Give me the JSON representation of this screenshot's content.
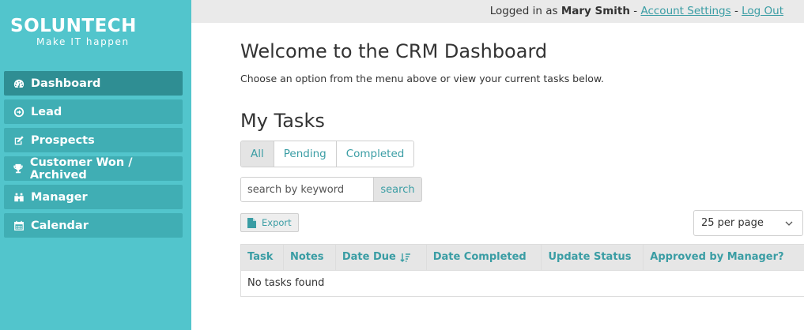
{
  "brand": {
    "name": "SOLUNTECH",
    "tagline": "Make IT happen"
  },
  "sidebar": {
    "items": [
      {
        "label": "Dashboard",
        "icon": "dashboard-icon",
        "active": true
      },
      {
        "label": "Lead",
        "icon": "arrow-circle-icon"
      },
      {
        "label": "Prospects",
        "icon": "edit-icon"
      },
      {
        "label": "Customer Won / Archived",
        "icon": "trophy-icon"
      },
      {
        "label": "Manager",
        "icon": "binoculars-icon"
      },
      {
        "label": "Calendar",
        "icon": "calendar-icon"
      }
    ]
  },
  "topbar": {
    "prefix": "Logged in as",
    "user": "Mary Smith",
    "separator": "-",
    "account_settings": "Account Settings",
    "logout": "Log Out"
  },
  "main": {
    "title": "Welcome to the CRM Dashboard",
    "subtitle": "Choose an option from the menu above or view your current tasks below.",
    "tasks_title": "My Tasks",
    "tabs": [
      {
        "label": "All",
        "active": true
      },
      {
        "label": "Pending"
      },
      {
        "label": "Completed"
      }
    ],
    "search": {
      "placeholder": "search by keyword",
      "value": "",
      "button": "search"
    },
    "export_label": "Export",
    "per_page": "25 per page",
    "table": {
      "columns": [
        "Task",
        "Notes",
        "Date Due",
        "Date Completed",
        "Update Status",
        "Approved by Manager?"
      ],
      "empty_message": "No tasks found"
    }
  },
  "colors": {
    "sidebar_bg": "#52c5cc",
    "menu_item_bg": "#40aeb4",
    "menu_item_active_bg": "#2f8e93",
    "accent": "#3a9da4"
  }
}
